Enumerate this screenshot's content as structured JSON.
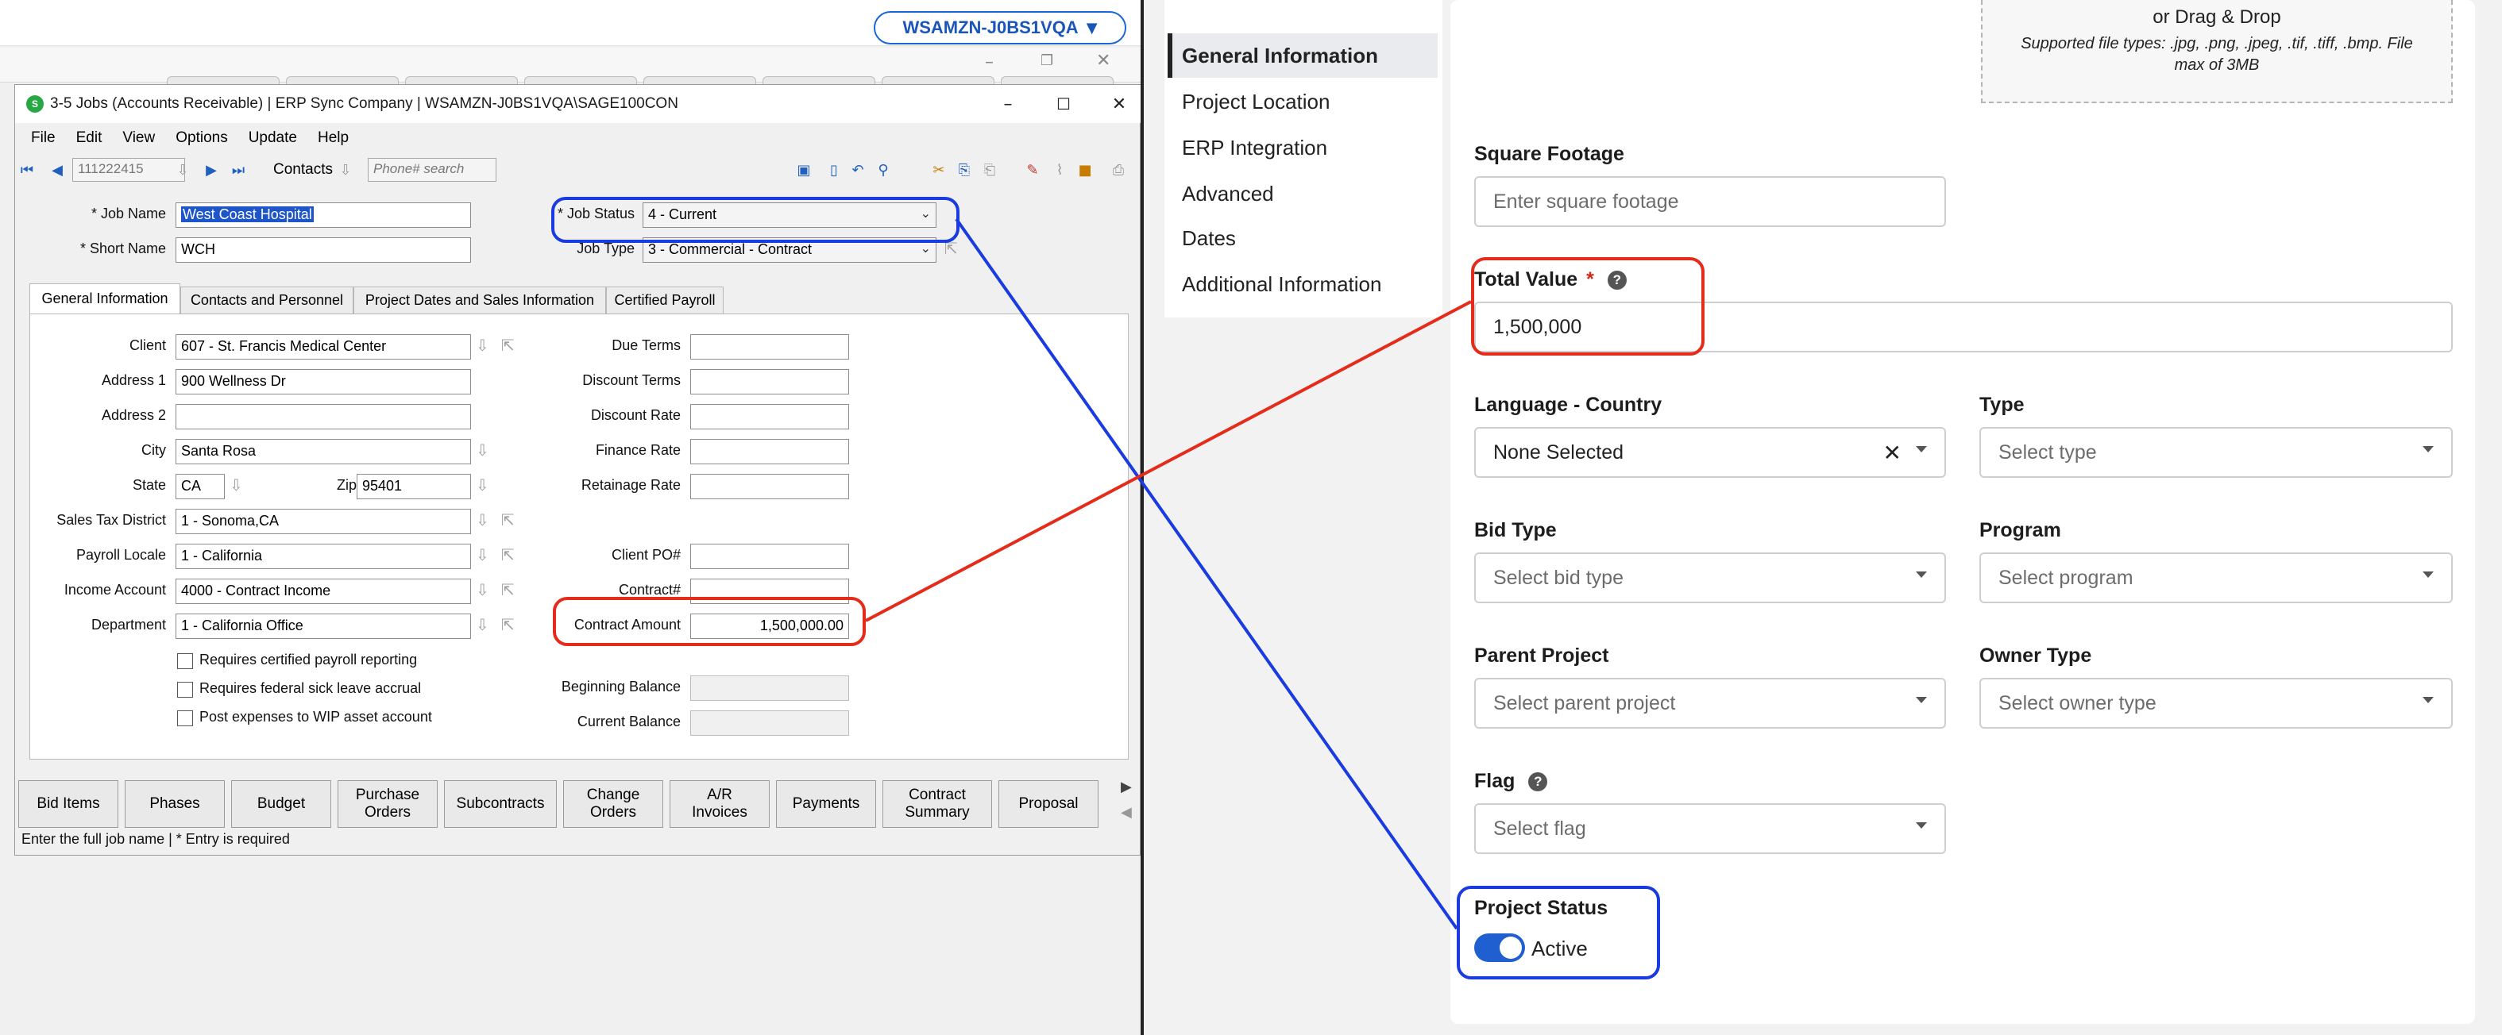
{
  "rdp": {
    "host_label": "WSAMZN-J0BS1VQA",
    "dropdown_icon": "caret-down-icon"
  },
  "erp": {
    "title": "3-5 Jobs (Accounts Receivable)  |  ERP Sync Company  |  WSAMZN-J0BS1VQA\\SAGE100CON",
    "menu": [
      "File",
      "Edit",
      "View",
      "Options",
      "Update",
      "Help"
    ],
    "toolbar": {
      "record_number": "111222415",
      "contacts_label": "Contacts",
      "phone_placeholder": "Phone# search"
    },
    "header": {
      "job_name_label": "* Job Name",
      "job_name_value": "West Coast Hospital",
      "short_name_label": "* Short Name",
      "short_name_value": "WCH",
      "job_status_label": "* Job Status",
      "job_status_value": "4 - Current",
      "job_type_label": "Job Type",
      "job_type_value": "3 - Commercial - Contract"
    },
    "tabs": [
      "General Information",
      "Contacts and Personnel",
      "Project Dates and Sales Information",
      "Certified Payroll"
    ],
    "general": {
      "client_label": "Client",
      "client_value": "607 - St. Francis Medical Center",
      "address1_label": "Address 1",
      "address1_value": "900 Wellness Dr",
      "address2_label": "Address 2",
      "address2_value": "",
      "city_label": "City",
      "city_value": "Santa Rosa",
      "state_label": "State",
      "state_value": "CA",
      "zip_label": "Zip",
      "zip_value": "95401",
      "sales_tax_label": "Sales Tax District",
      "sales_tax_value": "1 - Sonoma,CA",
      "payroll_locale_label": "Payroll Locale",
      "payroll_locale_value": "1 - California",
      "income_account_label": "Income Account",
      "income_account_value": "4000 - Contract Income",
      "department_label": "Department",
      "department_value": "1 - California Office",
      "due_terms_label": "Due Terms",
      "discount_terms_label": "Discount Terms",
      "discount_rate_label": "Discount Rate",
      "finance_rate_label": "Finance Rate",
      "retainage_rate_label": "Retainage Rate",
      "client_po_label": "Client PO#",
      "contract_no_label": "Contract#",
      "contract_amount_label": "Contract Amount",
      "contract_amount_value": "1,500,000.00",
      "beginning_balance_label": "Beginning Balance",
      "current_balance_label": "Current Balance",
      "chk_certified": "Requires certified payroll reporting",
      "chk_sick_leave": "Requires federal sick leave accrual",
      "chk_wip": "Post expenses to WIP asset account"
    },
    "bottom_buttons": [
      "Bid Items",
      "Phases",
      "Budget",
      "Purchase\nOrders",
      "Subcontracts",
      "Change\nOrders",
      "A/R\nInvoices",
      "Payments",
      "Contract\nSummary",
      "Proposal"
    ],
    "status_text": "Enter the full job name  |  * Entry is required"
  },
  "web": {
    "nav": [
      "General Information",
      "Project Location",
      "ERP Integration",
      "Advanced",
      "Dates",
      "Additional Information"
    ],
    "upload": {
      "drag_text": "or Drag & Drop",
      "types_text": "Supported file types: .jpg, .png, .jpeg, .tif, .tiff, .bmp. File max of 3MB"
    },
    "square_footage_label": "Square Footage",
    "square_footage_placeholder": "Enter square footage",
    "total_value_label": "Total Value",
    "required_mark": "*",
    "total_value_value": "1,500,000",
    "language_label": "Language - Country",
    "language_value": "None Selected",
    "type_label": "Type",
    "type_placeholder": "Select type",
    "bid_type_label": "Bid Type",
    "bid_type_placeholder": "Select bid type",
    "program_label": "Program",
    "program_placeholder": "Select program",
    "parent_project_label": "Parent Project",
    "parent_project_placeholder": "Select parent project",
    "owner_type_label": "Owner Type",
    "owner_type_placeholder": "Select owner type",
    "flag_label": "Flag",
    "flag_placeholder": "Select flag",
    "project_status_label": "Project Status",
    "project_status_value": "Active"
  },
  "colors": {
    "annotation_blue": "#1a3be0",
    "annotation_red": "#e52b1a",
    "toggle_on": "#1f5fcf",
    "rdp_accent": "#1a66d9"
  }
}
